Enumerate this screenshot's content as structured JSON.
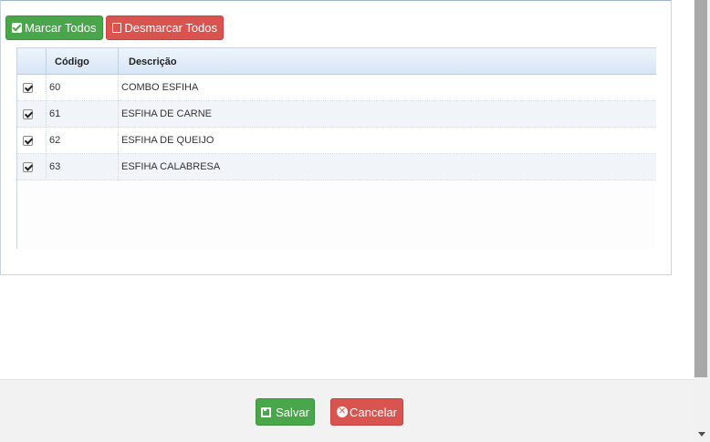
{
  "toolbar": {
    "select_all_label": "Marcar Todos",
    "deselect_all_label": "Desmarcar Todos"
  },
  "grid": {
    "columns": [
      "Código",
      "Descrição"
    ],
    "rows": [
      {
        "checked": true,
        "code": "60",
        "description": "COMBO ESFIHA"
      },
      {
        "checked": true,
        "code": "61",
        "description": "ESFIHA DE CARNE"
      },
      {
        "checked": true,
        "code": "62",
        "description": "ESFIHA DE QUEIJO"
      },
      {
        "checked": true,
        "code": "63",
        "description": "ESFIHA CALABRESA"
      }
    ]
  },
  "footer": {
    "save_label": "Salvar",
    "cancel_label": "Cancelar"
  },
  "icons": {
    "select_all": "check-square-icon",
    "deselect_all": "square-icon",
    "save": "floppy-disk-icon",
    "cancel": "times-circle-icon"
  },
  "colors": {
    "success": "#4aa64a",
    "danger": "#d9534f",
    "header_gradient_top": "#eef4fb",
    "header_gradient_bottom": "#d7e6f6",
    "row_alt": "#f1f5fa",
    "footer_bg": "#f2f2f2"
  }
}
